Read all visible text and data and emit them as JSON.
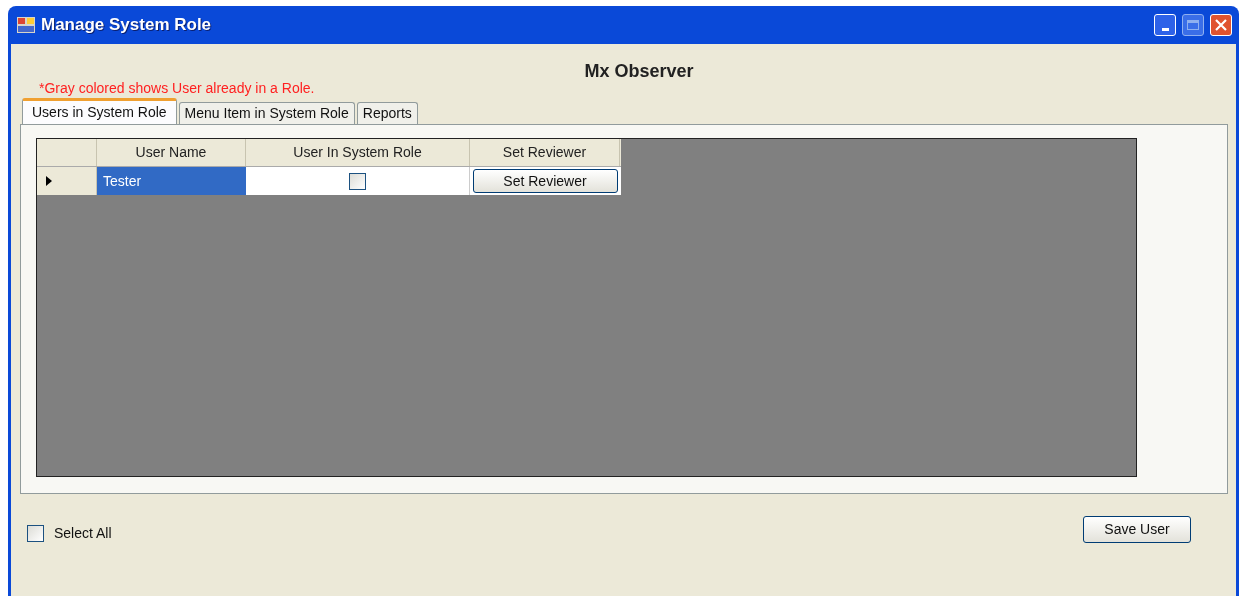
{
  "window": {
    "title": "Manage System Role"
  },
  "heading": "Mx Observer",
  "note": "*Gray colored shows User already in a Role.",
  "tabs": [
    {
      "label": "Users in System Role",
      "selected": true
    },
    {
      "label": "Menu Item in System Role",
      "selected": false
    },
    {
      "label": "Reports",
      "selected": false
    }
  ],
  "grid": {
    "columns": [
      "User Name",
      "User In System Role",
      "Set Reviewer"
    ],
    "rows": [
      {
        "current": true,
        "selected": true,
        "user_name": "Tester",
        "in_role": false,
        "button": "Set Reviewer"
      }
    ]
  },
  "select_all": {
    "label": "Select All",
    "checked": false
  },
  "save_button": "Save User"
}
